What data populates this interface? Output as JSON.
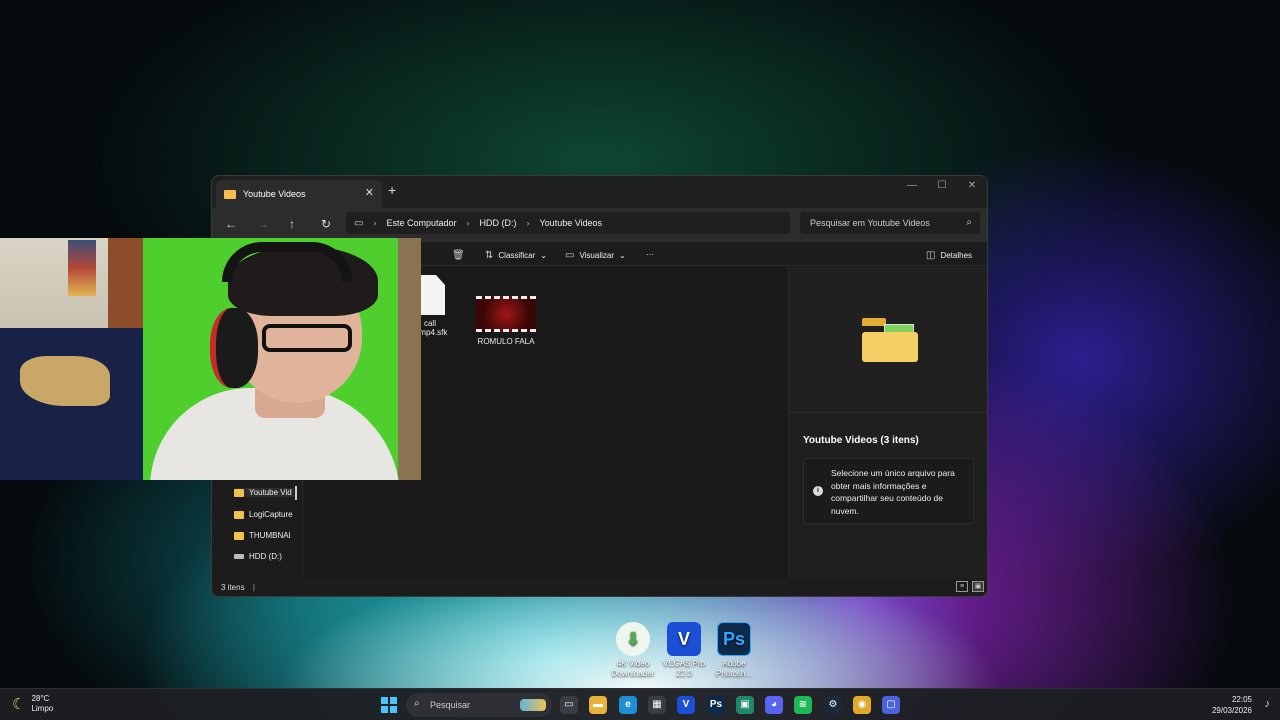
{
  "window": {
    "tab_title": "Youtube Videos",
    "tab_close": "✕",
    "new_tab": "+",
    "minimize": "—",
    "maximize": "☐",
    "close": "✕"
  },
  "nav": {
    "back": "←",
    "forward": "→",
    "up": "↑",
    "refresh": "↻",
    "breadcrumb": [
      "Este Computador",
      "HDD (D:)",
      "Youtube Videos"
    ],
    "search_placeholder": "Pesquisar em Youtube Videos"
  },
  "toolbar": {
    "sort_label": "Classificar",
    "view_label": "Visualizar",
    "more_label": "···",
    "details_label": "Detalhes"
  },
  "sidebar": {
    "items": [
      {
        "label": "Youtube Vid",
        "icon": "folder-icon"
      },
      {
        "label": "LogiCapture",
        "icon": "folder-icon"
      },
      {
        "label": "THUMBNAI",
        "icon": "folder-icon"
      },
      {
        "label": "HDD (D:)",
        "icon": "drive-icon"
      }
    ]
  },
  "files": [
    {
      "name_line1": "call",
      "name_line2": "n.mp4.sfk",
      "kind": "document"
    },
    {
      "name_line1": "ROMULO FALA",
      "kind": "video"
    }
  ],
  "details": {
    "title": "Youtube Videos (3 itens)",
    "info": "Selecione um único arquivo para obter mais informações e compartilhar seu conteúdo de nuvem."
  },
  "status": {
    "count": "3 itens"
  },
  "desktop_icons": [
    {
      "line1": "4K Video",
      "line2": "Downloader",
      "color": "#4cae4f",
      "glyph": "⬇"
    },
    {
      "line1": "VEGAS Pro",
      "line2": "22.0",
      "color": "#1a4fd6",
      "glyph": "V"
    },
    {
      "line1": "Adobe",
      "line2": "Photosh...",
      "color": "#0d2a4a",
      "glyph": "Ps"
    }
  ],
  "taskbar": {
    "temperature": "28°C",
    "condition": "Limpo",
    "search_label": "Pesquisar",
    "time": "22:05",
    "date": "29/03/2026",
    "apps": [
      {
        "name": "task-view",
        "glyph": "▭",
        "color": "#3a3d44"
      },
      {
        "name": "file-explorer",
        "glyph": "▬",
        "color": "#e8b33a"
      },
      {
        "name": "edge",
        "glyph": "e",
        "color": "#1f8fd8"
      },
      {
        "name": "store",
        "glyph": "▦",
        "color": "#3a3d44"
      },
      {
        "name": "vegas",
        "glyph": "V",
        "color": "#1a4fd6"
      },
      {
        "name": "photoshop",
        "glyph": "Ps",
        "color": "#0d2a4a"
      },
      {
        "name": "app-green",
        "glyph": "▣",
        "color": "#1f8a6a"
      },
      {
        "name": "discord",
        "glyph": "◕",
        "color": "#5865f2"
      },
      {
        "name": "spotify",
        "glyph": "≋",
        "color": "#1db954"
      },
      {
        "name": "steam",
        "glyph": "⚙",
        "color": "#1b2838"
      },
      {
        "name": "chrome",
        "glyph": "◉",
        "color": "#e0a92c"
      },
      {
        "name": "app-active",
        "glyph": "▢",
        "color": "#4a63d8"
      }
    ]
  }
}
